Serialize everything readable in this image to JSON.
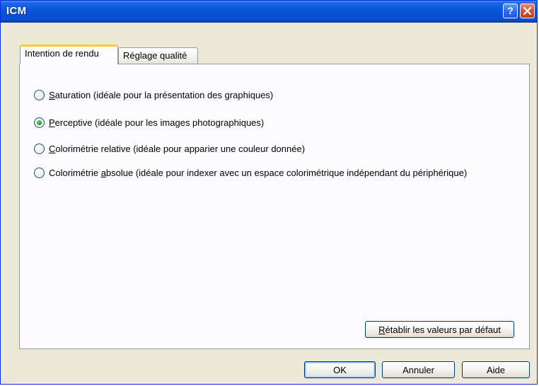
{
  "window": {
    "title": "ICM",
    "help_glyph": "?",
    "close_icon": "close-x-icon"
  },
  "tabs": [
    {
      "label": "Intention de rendu",
      "active": true
    },
    {
      "label": "Réglage qualité",
      "active": false
    }
  ],
  "options": [
    {
      "accel": "S",
      "rest": "aturation (idéale pour la présentation des graphiques)",
      "checked": false
    },
    {
      "accel": "P",
      "rest": "erceptive (idéale pour les images photographiques)",
      "checked": true
    },
    {
      "accel": "C",
      "rest": "olorimétrie relative (idéale pour apparier une couleur donnée)",
      "checked": false
    },
    {
      "pre": "Colorimétrie ",
      "accel": "a",
      "rest": "bsolue (idéale pour indexer avec un espace colorimétrique indépendant du périphérique)",
      "checked": false
    }
  ],
  "reset_button": {
    "accel": "R",
    "rest": "établir les valeurs par défaut"
  },
  "footer": {
    "ok": "OK",
    "cancel": "Annuler",
    "help": "Aide"
  },
  "colors": {
    "titlebar": "#0a55d8",
    "dialog_bg": "#ece9d8",
    "active_tab_accent": "#ffc83c",
    "radio_checked": "#21a121"
  }
}
